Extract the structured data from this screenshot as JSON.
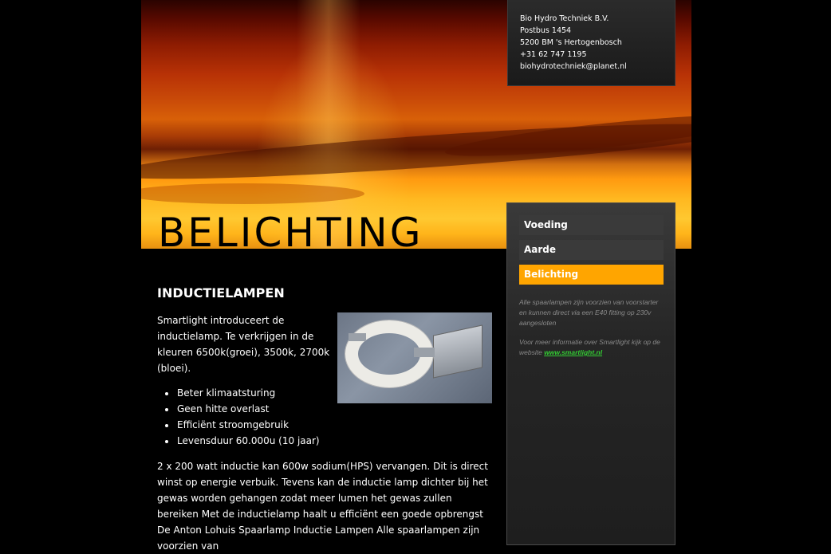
{
  "contact": {
    "company": "Bio Hydro Techniek B.V.",
    "postbus": "Postbus 1454",
    "city": "5200 BM 's Hertogenbosch",
    "phone": "+31 62 747 1195",
    "email": "biohydrotechniek@planet.nl"
  },
  "page_title": "BELICHTING",
  "nav": {
    "items": [
      {
        "label": "Voeding"
      },
      {
        "label": "Aarde"
      },
      {
        "label": "Belichting"
      }
    ],
    "active_color": "#ffa500"
  },
  "sidebar": {
    "note1": "Alle spaarlampen zijn voorzien van voorstarter en kunnen direct via een E40 fitting op 230v aangesloten",
    "note2_prefix": "Voor meer informatie over Smartlight kijk op de website ",
    "note2_link": "www.smartlight.nl"
  },
  "main": {
    "section_title": "INDUCTIELAMPEN",
    "intro": "Smartlight introduceert de inductielamp. Te verkrijgen in de kleuren 6500k(groei), 3500k, 2700k (bloei).",
    "photo_icon": "induction-lamp-photo",
    "bullets": [
      "Beter klimaatsturing",
      "Geen hitte overlast",
      "Efficiënt stroomgebruik",
      "Levensduur 60.000u (10 jaar)"
    ],
    "body": "2 x 200 watt inductie kan 600w sodium(HPS) vervangen. Dit is direct winst op energie verbuik. Tevens kan de inductie lamp dichter bij het gewas worden gehangen zodat meer lumen het gewas zullen bereiken Met de inductielamp haalt u efficiënt een goede opbrengst De Anton Lohuis Spaarlamp Inductie Lampen Alle spaarlampen zijn voorzien van"
  }
}
